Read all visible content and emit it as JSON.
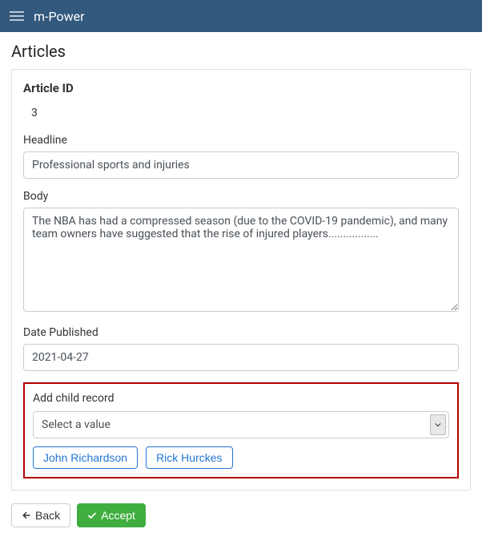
{
  "navbar": {
    "title": "m-Power"
  },
  "page": {
    "heading": "Articles"
  },
  "form": {
    "article_id": {
      "label": "Article ID",
      "value": "3"
    },
    "headline": {
      "label": "Headline",
      "value": "Professional sports and injuries"
    },
    "body": {
      "label": "Body",
      "value": "The NBA has had a compressed season (due to the COVID-19 pandemic), and many team owners have suggested that the rise of injured players................."
    },
    "date_published": {
      "label": "Date Published",
      "value": "2021-04-27"
    },
    "child_record": {
      "label": "Add child record",
      "placeholder": "Select a value",
      "chips": [
        "John Richardson",
        "Rick Hurckes"
      ]
    }
  },
  "buttons": {
    "back": "Back",
    "accept": "Accept"
  }
}
